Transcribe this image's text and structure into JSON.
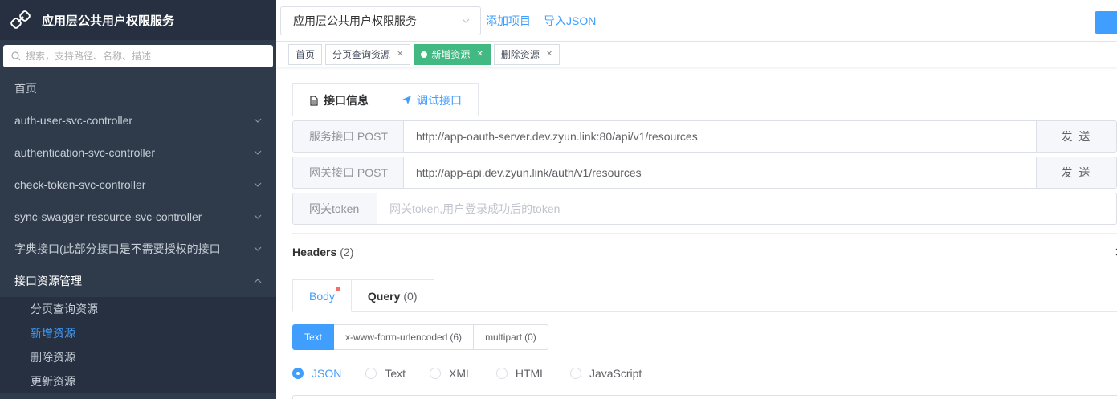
{
  "app": {
    "title": "应用层公共用户权限服务"
  },
  "search": {
    "placeholder": "搜索，支持路径、名称、描述"
  },
  "sidebar": {
    "items": [
      {
        "label": "首页"
      },
      {
        "label": "auth-user-svc-controller"
      },
      {
        "label": "authentication-svc-controller"
      },
      {
        "label": "check-token-svc-controller"
      },
      {
        "label": "sync-swagger-resource-svc-controller"
      },
      {
        "label": "字典接口(此部分接口是不需要授权的接口"
      },
      {
        "label": "接口资源管理"
      }
    ],
    "sub_items": [
      {
        "label": "分页查询资源"
      },
      {
        "label": "新增资源"
      },
      {
        "label": "删除资源"
      },
      {
        "label": "更新资源"
      }
    ]
  },
  "topbar": {
    "project_select": "应用层公共用户权限服务",
    "add_project": "添加项目",
    "import_json": "导入JSON"
  },
  "tags": [
    {
      "label": "首页"
    },
    {
      "label": "分页查询资源"
    },
    {
      "label": "新增资源"
    },
    {
      "label": "删除资源"
    }
  ],
  "tabs": {
    "info": "接口信息",
    "debug": "调试接口"
  },
  "service": {
    "label": "服务接口 POST",
    "url": "http://app-oauth-server.dev.zyun.link:80/api/v1/resources",
    "send": "发 送"
  },
  "gateway": {
    "label": "网关接口 POST",
    "url": "http://app-api.dev.zyun.link/auth/v1/resources",
    "send": "发 送"
  },
  "token": {
    "label": "网关token",
    "placeholder": "网关token,用户登录成功后的token"
  },
  "headers": {
    "label": "Headers",
    "count": "(2)"
  },
  "body_tabs": {
    "body": "Body",
    "query": "Query",
    "query_count": "(0)"
  },
  "body_types": {
    "text": "Text",
    "urlencoded": "x-www-form-urlencoded",
    "urlencoded_count": "(6)",
    "multipart": "multipart",
    "multipart_count": "(0)"
  },
  "formats": [
    "JSON",
    "Text",
    "XML",
    "HTML",
    "JavaScript"
  ],
  "colors": {
    "sidebar": "#2f3b4a",
    "accent": "#409eff",
    "active_tag": "#42b983"
  }
}
